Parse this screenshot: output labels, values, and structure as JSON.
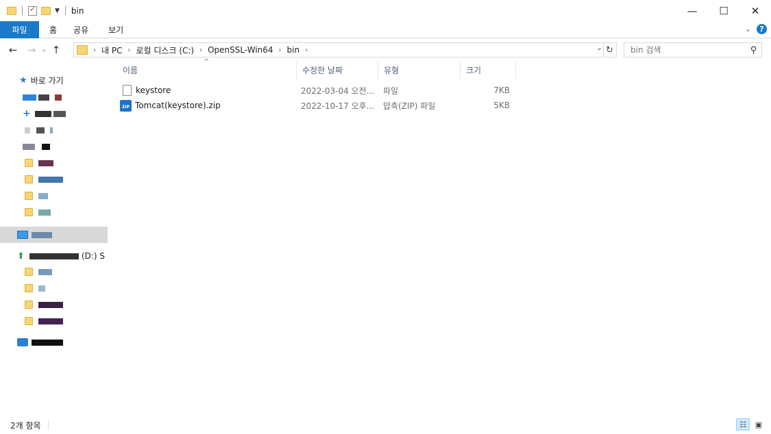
{
  "window": {
    "title": "bin",
    "minimize": "—",
    "maximize": "☐",
    "close": "✕"
  },
  "ribbon": {
    "tabs": [
      "파일",
      "홈",
      "공유",
      "보기"
    ],
    "expand": "⌄",
    "help": "?"
  },
  "address": {
    "back": "←",
    "forward": "→",
    "recent": "⌄",
    "up": "↑",
    "crumbs": [
      "내 PC",
      "로컬 디스크 (C:)",
      "OpenSSL-Win64",
      "bin"
    ],
    "dropdown": "⌄",
    "refresh": "↻"
  },
  "search": {
    "placeholder": "bin 검색",
    "icon": "⚲"
  },
  "nav": {
    "quick_access": "바로 가기",
    "drive_label": "(D:) S",
    "pin": "📌"
  },
  "columns": [
    "이름",
    "수정한 날짜",
    "유형",
    "크기"
  ],
  "sort_indicator": "^",
  "files": [
    {
      "name": "keystore",
      "modified": "2022-03-04 오전...",
      "type": "파일",
      "size": "7KB",
      "icon": "document-icon"
    },
    {
      "name": "Tomcat(keystore).zip",
      "modified": "2022-10-17 오후...",
      "type": "압축(ZIP) 파일",
      "size": "5KB",
      "icon": "zip-icon"
    }
  ],
  "zip_label": "ZIP",
  "status": {
    "item_count": "2개 항목"
  },
  "colors": {
    "accent": "#1979ca",
    "selection": "#cce8ff",
    "header_text": "#4c607a"
  }
}
